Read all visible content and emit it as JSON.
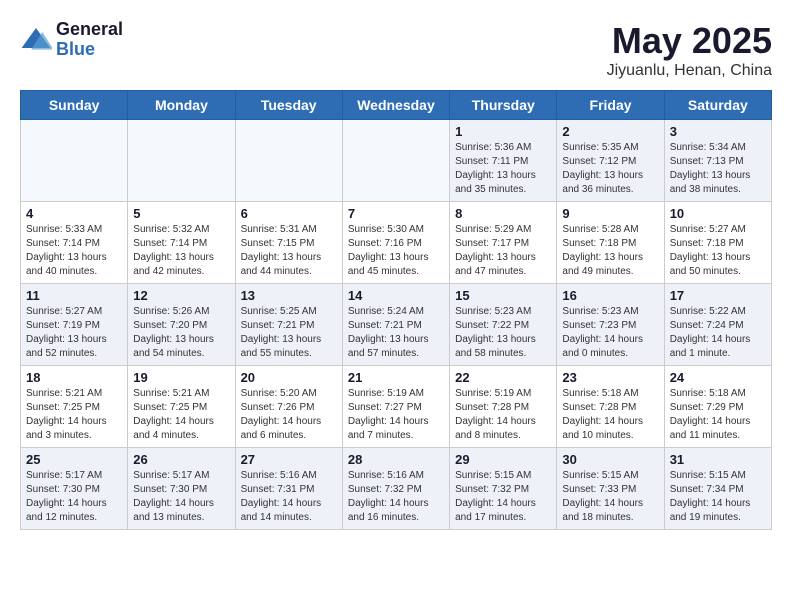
{
  "logo": {
    "general": "General",
    "blue": "Blue"
  },
  "title": "May 2025",
  "subtitle": "Jiyuanlu, Henan, China",
  "days_of_week": [
    "Sunday",
    "Monday",
    "Tuesday",
    "Wednesday",
    "Thursday",
    "Friday",
    "Saturday"
  ],
  "weeks": [
    [
      {
        "day": "",
        "info": ""
      },
      {
        "day": "",
        "info": ""
      },
      {
        "day": "",
        "info": ""
      },
      {
        "day": "",
        "info": ""
      },
      {
        "day": "1",
        "info": "Sunrise: 5:36 AM\nSunset: 7:11 PM\nDaylight: 13 hours\nand 35 minutes."
      },
      {
        "day": "2",
        "info": "Sunrise: 5:35 AM\nSunset: 7:12 PM\nDaylight: 13 hours\nand 36 minutes."
      },
      {
        "day": "3",
        "info": "Sunrise: 5:34 AM\nSunset: 7:13 PM\nDaylight: 13 hours\nand 38 minutes."
      }
    ],
    [
      {
        "day": "4",
        "info": "Sunrise: 5:33 AM\nSunset: 7:14 PM\nDaylight: 13 hours\nand 40 minutes."
      },
      {
        "day": "5",
        "info": "Sunrise: 5:32 AM\nSunset: 7:14 PM\nDaylight: 13 hours\nand 42 minutes."
      },
      {
        "day": "6",
        "info": "Sunrise: 5:31 AM\nSunset: 7:15 PM\nDaylight: 13 hours\nand 44 minutes."
      },
      {
        "day": "7",
        "info": "Sunrise: 5:30 AM\nSunset: 7:16 PM\nDaylight: 13 hours\nand 45 minutes."
      },
      {
        "day": "8",
        "info": "Sunrise: 5:29 AM\nSunset: 7:17 PM\nDaylight: 13 hours\nand 47 minutes."
      },
      {
        "day": "9",
        "info": "Sunrise: 5:28 AM\nSunset: 7:18 PM\nDaylight: 13 hours\nand 49 minutes."
      },
      {
        "day": "10",
        "info": "Sunrise: 5:27 AM\nSunset: 7:18 PM\nDaylight: 13 hours\nand 50 minutes."
      }
    ],
    [
      {
        "day": "11",
        "info": "Sunrise: 5:27 AM\nSunset: 7:19 PM\nDaylight: 13 hours\nand 52 minutes."
      },
      {
        "day": "12",
        "info": "Sunrise: 5:26 AM\nSunset: 7:20 PM\nDaylight: 13 hours\nand 54 minutes."
      },
      {
        "day": "13",
        "info": "Sunrise: 5:25 AM\nSunset: 7:21 PM\nDaylight: 13 hours\nand 55 minutes."
      },
      {
        "day": "14",
        "info": "Sunrise: 5:24 AM\nSunset: 7:21 PM\nDaylight: 13 hours\nand 57 minutes."
      },
      {
        "day": "15",
        "info": "Sunrise: 5:23 AM\nSunset: 7:22 PM\nDaylight: 13 hours\nand 58 minutes."
      },
      {
        "day": "16",
        "info": "Sunrise: 5:23 AM\nSunset: 7:23 PM\nDaylight: 14 hours\nand 0 minutes."
      },
      {
        "day": "17",
        "info": "Sunrise: 5:22 AM\nSunset: 7:24 PM\nDaylight: 14 hours\nand 1 minute."
      }
    ],
    [
      {
        "day": "18",
        "info": "Sunrise: 5:21 AM\nSunset: 7:25 PM\nDaylight: 14 hours\nand 3 minutes."
      },
      {
        "day": "19",
        "info": "Sunrise: 5:21 AM\nSunset: 7:25 PM\nDaylight: 14 hours\nand 4 minutes."
      },
      {
        "day": "20",
        "info": "Sunrise: 5:20 AM\nSunset: 7:26 PM\nDaylight: 14 hours\nand 6 minutes."
      },
      {
        "day": "21",
        "info": "Sunrise: 5:19 AM\nSunset: 7:27 PM\nDaylight: 14 hours\nand 7 minutes."
      },
      {
        "day": "22",
        "info": "Sunrise: 5:19 AM\nSunset: 7:28 PM\nDaylight: 14 hours\nand 8 minutes."
      },
      {
        "day": "23",
        "info": "Sunrise: 5:18 AM\nSunset: 7:28 PM\nDaylight: 14 hours\nand 10 minutes."
      },
      {
        "day": "24",
        "info": "Sunrise: 5:18 AM\nSunset: 7:29 PM\nDaylight: 14 hours\nand 11 minutes."
      }
    ],
    [
      {
        "day": "25",
        "info": "Sunrise: 5:17 AM\nSunset: 7:30 PM\nDaylight: 14 hours\nand 12 minutes."
      },
      {
        "day": "26",
        "info": "Sunrise: 5:17 AM\nSunset: 7:30 PM\nDaylight: 14 hours\nand 13 minutes."
      },
      {
        "day": "27",
        "info": "Sunrise: 5:16 AM\nSunset: 7:31 PM\nDaylight: 14 hours\nand 14 minutes."
      },
      {
        "day": "28",
        "info": "Sunrise: 5:16 AM\nSunset: 7:32 PM\nDaylight: 14 hours\nand 16 minutes."
      },
      {
        "day": "29",
        "info": "Sunrise: 5:15 AM\nSunset: 7:32 PM\nDaylight: 14 hours\nand 17 minutes."
      },
      {
        "day": "30",
        "info": "Sunrise: 5:15 AM\nSunset: 7:33 PM\nDaylight: 14 hours\nand 18 minutes."
      },
      {
        "day": "31",
        "info": "Sunrise: 5:15 AM\nSunset: 7:34 PM\nDaylight: 14 hours\nand 19 minutes."
      }
    ]
  ]
}
